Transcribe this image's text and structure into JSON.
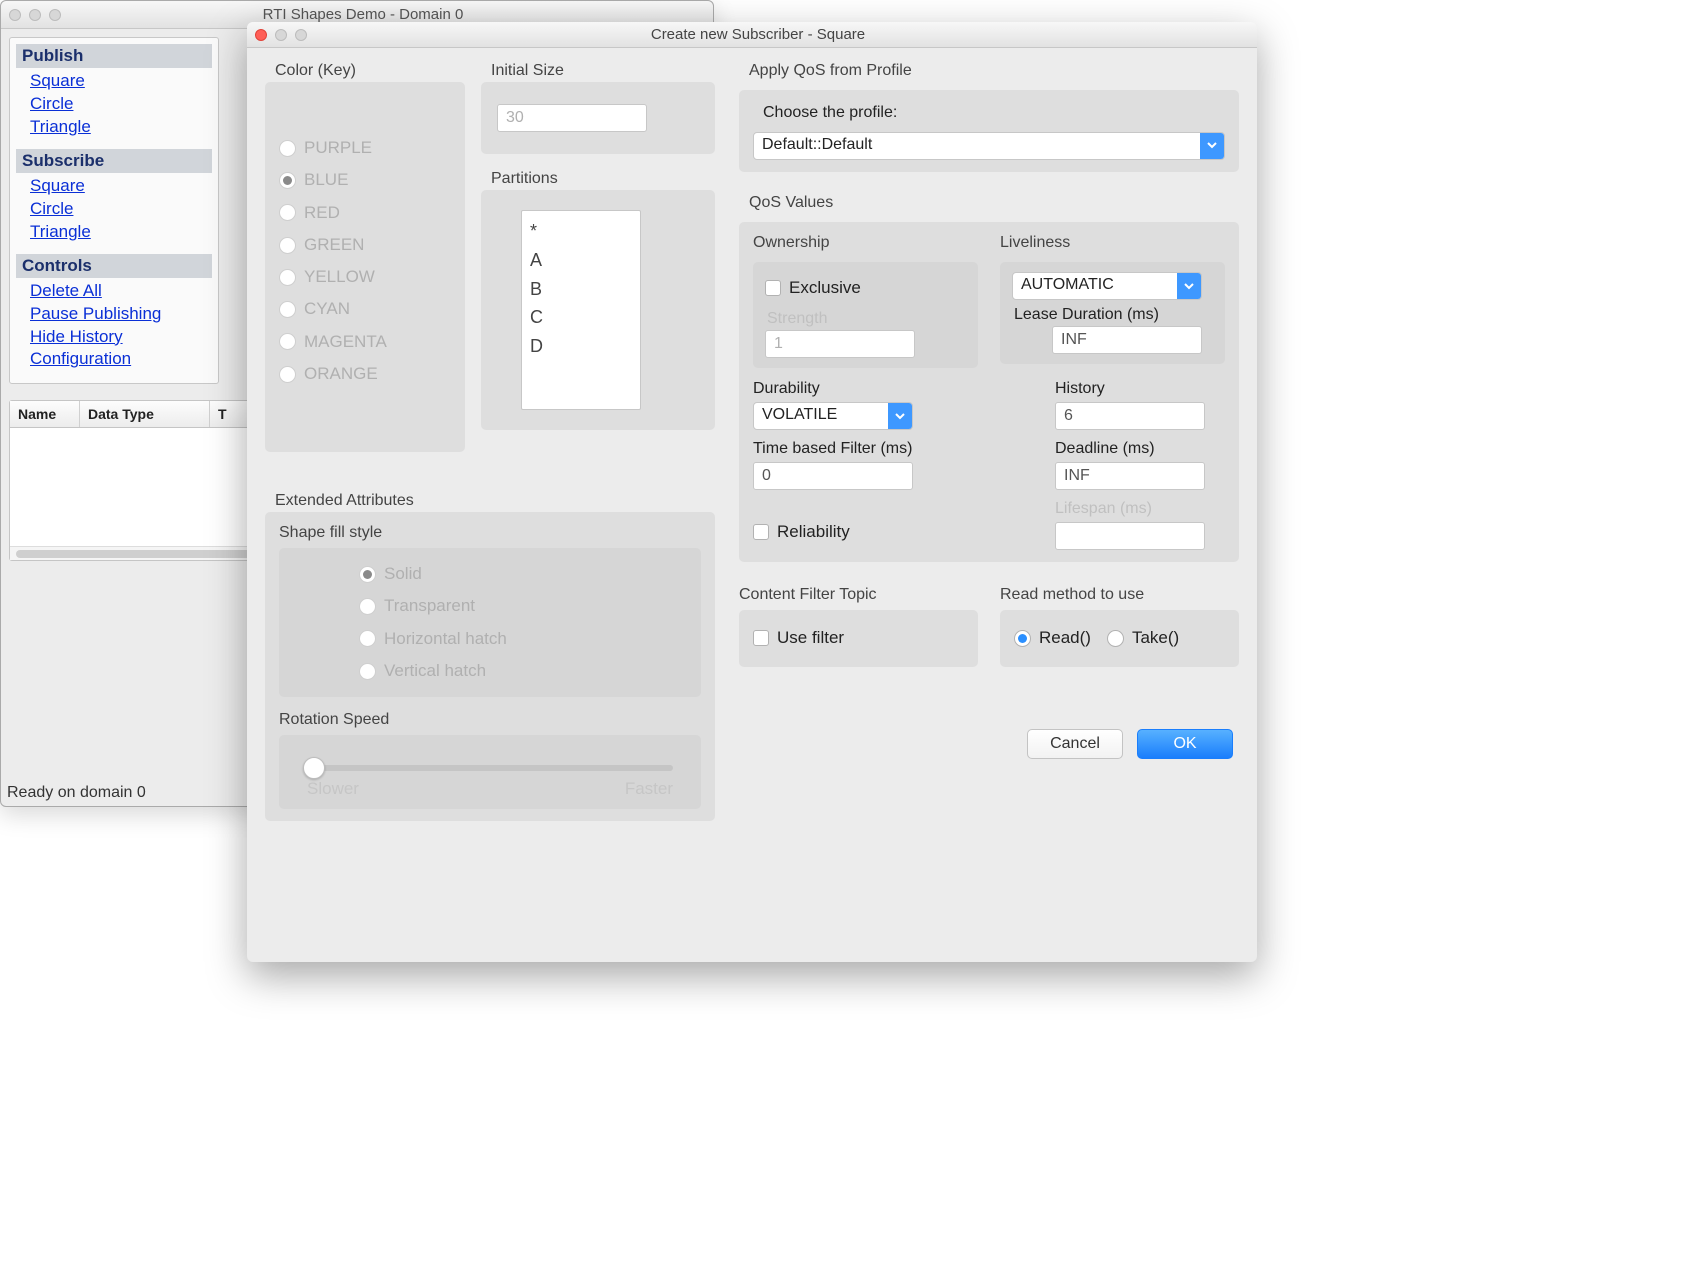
{
  "mainWindow": {
    "title": "RTI Shapes Demo - Domain 0",
    "sections": {
      "publish": {
        "header": "Publish",
        "items": [
          "Square",
          "Circle",
          "Triangle"
        ]
      },
      "subscribe": {
        "header": "Subscribe",
        "items": [
          "Square",
          "Circle",
          "Triangle"
        ]
      },
      "controls": {
        "header": "Controls",
        "items": [
          "Delete All",
          "Pause Publishing",
          "Hide History",
          "Configuration"
        ]
      }
    },
    "table": {
      "col1": "Name",
      "col2": "Data Type",
      "col3": "T"
    },
    "status": "Ready on domain 0"
  },
  "dialog": {
    "title": "Create new Subscriber - Square",
    "colorKey": {
      "label": "Color (Key)",
      "options": [
        "PURPLE",
        "BLUE",
        "RED",
        "GREEN",
        "YELLOW",
        "CYAN",
        "MAGENTA",
        "ORANGE"
      ],
      "selected": "BLUE"
    },
    "initialSize": {
      "label": "Initial Size",
      "value": "30"
    },
    "partitions": {
      "label": "Partitions",
      "items": [
        "*",
        "A",
        "B",
        "C",
        "D"
      ]
    },
    "extAttr": {
      "label": "Extended Attributes",
      "fillStyle": {
        "label": "Shape fill style",
        "options": [
          "Solid",
          "Transparent",
          "Horizontal hatch",
          "Vertical hatch"
        ],
        "selected": "Solid"
      },
      "rotation": {
        "label": "Rotation Speed",
        "min": "Slower",
        "max": "Faster"
      }
    },
    "profile": {
      "label": "Apply QoS from Profile",
      "choose": "Choose the profile:",
      "value": "Default::Default"
    },
    "qos": {
      "label": "QoS Values",
      "ownership": {
        "label": "Ownership",
        "exclusive": "Exclusive",
        "strengthLabel": "Strength",
        "strength": "1"
      },
      "liveliness": {
        "label": "Liveliness",
        "kind": "AUTOMATIC",
        "leaseLabel": "Lease Duration (ms)",
        "lease": "INF"
      },
      "durability": {
        "label": "Durability",
        "value": "VOLATILE"
      },
      "timeFilter": {
        "label": "Time based Filter (ms)",
        "value": "0"
      },
      "history": {
        "label": "History",
        "value": "6"
      },
      "deadline": {
        "label": "Deadline (ms)",
        "value": "INF"
      },
      "lifespan": {
        "label": "Lifespan (ms)",
        "value": ""
      },
      "reliability": "Reliability"
    },
    "cft": {
      "label": "Content Filter Topic",
      "useFilter": "Use filter"
    },
    "readMethod": {
      "label": "Read method to use",
      "read": "Read()",
      "take": "Take()",
      "selected": "Read()"
    },
    "buttons": {
      "cancel": "Cancel",
      "ok": "OK"
    }
  }
}
